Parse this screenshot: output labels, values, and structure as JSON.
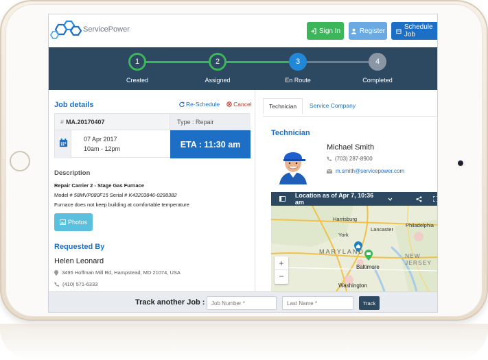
{
  "header": {
    "brand": "ServicePower",
    "signin_label": "Sign In",
    "register_label": "Register",
    "schedule_label": "Schedule Job"
  },
  "progress": {
    "steps": [
      {
        "number": "1",
        "label": "Created",
        "state": "done"
      },
      {
        "number": "2",
        "label": "Assigned",
        "state": "done"
      },
      {
        "number": "3",
        "label": "En Route",
        "state": "current"
      },
      {
        "number": "4",
        "label": "Completed",
        "state": "pending"
      }
    ]
  },
  "job": {
    "title": "Job details",
    "reschedule_label": "Re-Schedule",
    "cancel_label": "Cancel",
    "number_prefix": "#",
    "number": "MA.20170407",
    "type": "Type : Repair",
    "date": "07 Apr 2017",
    "time_window": "10am - 12pm",
    "eta": "ETA : 11:30 am"
  },
  "description": {
    "title": "Description",
    "heading": "Repair Carrier 2 - Stage Gas Furnace",
    "model_label": "Model #",
    "model_value": "58MVP080F15",
    "serial_label": "Serial #",
    "serial_value": "K43203846-0298382",
    "note": "Furnace does not keep building at comfortable temperature",
    "photos_label": "Photos"
  },
  "requester": {
    "title": "Requested By",
    "name": "Helen Leonard",
    "address": "3495 Hoffman Mill Rd, Hampstead, MD 21074, USA",
    "phone": "(410) 571-6333"
  },
  "tabs": [
    "Technician",
    "Service Company"
  ],
  "technician": {
    "section_title": "Technician",
    "name": "Michael Smith",
    "phone": "(703) 287-8900",
    "email": "m.smith@servicepower.com"
  },
  "map": {
    "location_text": "Location as of Apr 7, 10:36 am",
    "labels": [
      "Harrisburg",
      "Lancaster",
      "Philadelphia",
      "York",
      "MARYLAND",
      "Baltimore",
      "Washington",
      "NEW JERSEY"
    ],
    "zoom_in": "+",
    "zoom_out": "−"
  },
  "footer": {
    "label": "Track another Job :",
    "job_placeholder": "Job Number *",
    "lastname_placeholder": "Last Name *",
    "button": "Track"
  },
  "colors": {
    "accent": "#1c6fc4",
    "nav": "#2c4961",
    "step_done": "#3db55a",
    "step_current": "#2188d8",
    "step_pending": "#8a96a3"
  }
}
